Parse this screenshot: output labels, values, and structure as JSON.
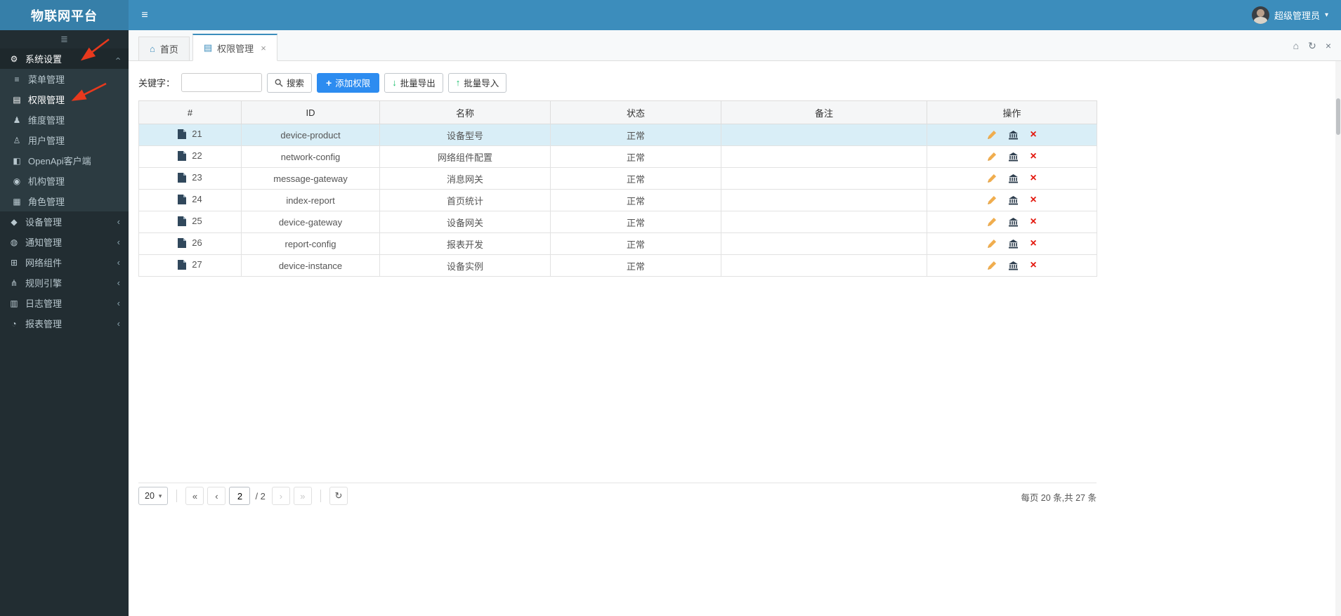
{
  "brand": "物联网平台",
  "topbar": {
    "user_name": "超级管理员"
  },
  "colors": {
    "topbar": "#3c8dbc",
    "brand-bg": "#367fa9",
    "sidebar-bg": "#222d32",
    "submenu-bg": "#2c3b41",
    "active-item-bg": "#1e282c",
    "sidebar-text": "#b8c7ce",
    "selected-row": "#d9eef7",
    "primary-btn": "#2d8cf0",
    "edit-icon": "#f0ad4e",
    "detail-icon": "#2e3e4e",
    "delete-icon": "#e3170d",
    "success-icon": "#19be6b",
    "annotation": "#e8391d"
  },
  "icons": {
    "hamburger": "≡",
    "collapse": "≣",
    "home": "⌂",
    "refresh": "↻",
    "close": "×",
    "caret_down": "▾",
    "chevron_left": "‹",
    "first_page": "«",
    "prev_page": "‹",
    "next_page": "›",
    "last_page": "»",
    "plus": "+",
    "download": "↓",
    "upload": "↑",
    "delete": "×"
  },
  "sidebar": {
    "items": [
      {
        "name": "system-settings",
        "label": "系统设置",
        "icon": "gear-icon",
        "glyph": "⚙",
        "expanded": true,
        "children": [
          {
            "name": "menu-management",
            "label": "菜单管理",
            "icon": "list-icon",
            "glyph": "≡"
          },
          {
            "name": "permission-management",
            "label": "权限管理",
            "icon": "permission-icon",
            "glyph": "▤",
            "active": true
          },
          {
            "name": "dimension-management",
            "label": "维度管理",
            "icon": "users-icon",
            "glyph": "♟"
          },
          {
            "name": "user-management",
            "label": "用户管理",
            "icon": "user-icon",
            "glyph": "♙"
          },
          {
            "name": "openapi-client",
            "label": "OpenApi客户端",
            "icon": "client-icon",
            "glyph": "◧"
          },
          {
            "name": "organization-management",
            "label": "机构管理",
            "icon": "organization-icon",
            "glyph": "◉"
          },
          {
            "name": "role-management",
            "label": "角色管理",
            "icon": "role-icon",
            "glyph": "▦"
          }
        ]
      },
      {
        "name": "device-management",
        "label": "设备管理",
        "icon": "device-icon",
        "glyph": "◆"
      },
      {
        "name": "notification-management",
        "label": "通知管理",
        "icon": "notification-icon",
        "glyph": "◍"
      },
      {
        "name": "network-components",
        "label": "网络组件",
        "icon": "network-icon",
        "glyph": "⊞"
      },
      {
        "name": "rule-engine",
        "label": "规则引擎",
        "icon": "rule-engine-icon",
        "glyph": "⋔"
      },
      {
        "name": "log-management",
        "label": "日志管理",
        "icon": "log-icon",
        "glyph": "▥"
      },
      {
        "name": "report-management",
        "label": "报表管理",
        "icon": "report-icon",
        "glyph": "◔"
      }
    ]
  },
  "tabs": [
    {
      "name": "home",
      "label": "首页",
      "glyph": "⌂",
      "active": false,
      "closable": false
    },
    {
      "name": "permission",
      "label": "权限管理",
      "glyph": "▤",
      "active": true,
      "closable": true
    }
  ],
  "toolbar": {
    "keyword_label": "关键字：",
    "search_label": "搜索",
    "add_label": "添加权限",
    "export_label": "批量导出",
    "import_label": "批量导入"
  },
  "table": {
    "columns": [
      "#",
      "ID",
      "名称",
      "状态",
      "备注",
      "操作"
    ],
    "rows": [
      {
        "num": "21",
        "id": "device-product",
        "name": "设备型号",
        "status": "正常",
        "remark": "",
        "selected": true
      },
      {
        "num": "22",
        "id": "network-config",
        "name": "网络组件配置",
        "status": "正常",
        "remark": ""
      },
      {
        "num": "23",
        "id": "message-gateway",
        "name": "消息网关",
        "status": "正常",
        "remark": ""
      },
      {
        "num": "24",
        "id": "index-report",
        "name": "首页统计",
        "status": "正常",
        "remark": ""
      },
      {
        "num": "25",
        "id": "device-gateway",
        "name": "设备网关",
        "status": "正常",
        "remark": ""
      },
      {
        "num": "26",
        "id": "report-config",
        "name": "报表开发",
        "status": "正常",
        "remark": ""
      },
      {
        "num": "27",
        "id": "device-instance",
        "name": "设备实例",
        "status": "正常",
        "remark": ""
      }
    ]
  },
  "pagination": {
    "page_size": "20",
    "current_page": "2",
    "total_pages_label": "/ 2",
    "summary": "每页 20 条,共 27 条"
  }
}
